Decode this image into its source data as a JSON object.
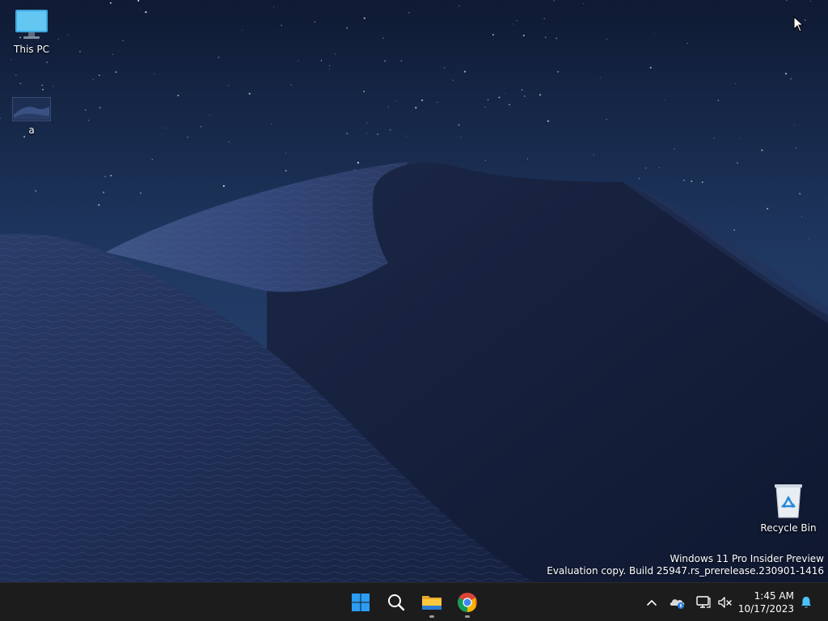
{
  "desktop": {
    "icons": [
      {
        "label": "This PC",
        "icon": "monitor-icon"
      },
      {
        "label": "a",
        "icon": "image-file-icon"
      },
      {
        "label": "Recycle Bin",
        "icon": "recycle-bin-icon"
      }
    ],
    "watermark": {
      "line1": "Windows 11 Pro Insider Preview",
      "line2": "Evaluation copy. Build 25947.rs_prerelease.230901-1416"
    }
  },
  "taskbar": {
    "pinned": [
      {
        "name": "Start",
        "icon": "windows-start-icon"
      },
      {
        "name": "Search",
        "icon": "search-icon"
      },
      {
        "name": "File Explorer",
        "icon": "folder-icon",
        "running": true
      },
      {
        "name": "Google Chrome",
        "icon": "chrome-icon",
        "running": true
      }
    ],
    "tray": {
      "icons": [
        "chevron-up-icon",
        "onedrive-icon",
        "network-icon",
        "volume-muted-icon",
        "notification-bell-icon"
      ]
    },
    "clock": {
      "time": "1:45 AM",
      "date": "10/17/2023"
    }
  },
  "colors": {
    "taskbar_bg": "#1c1c1c",
    "sky_top": "#0f1a33",
    "sky_bottom": "#2a4a78",
    "dune_dark": "#141e36",
    "dune_light": "#3a4f7c",
    "accent_blue": "#0078d4",
    "bell_blue": "#4cc2ff"
  }
}
